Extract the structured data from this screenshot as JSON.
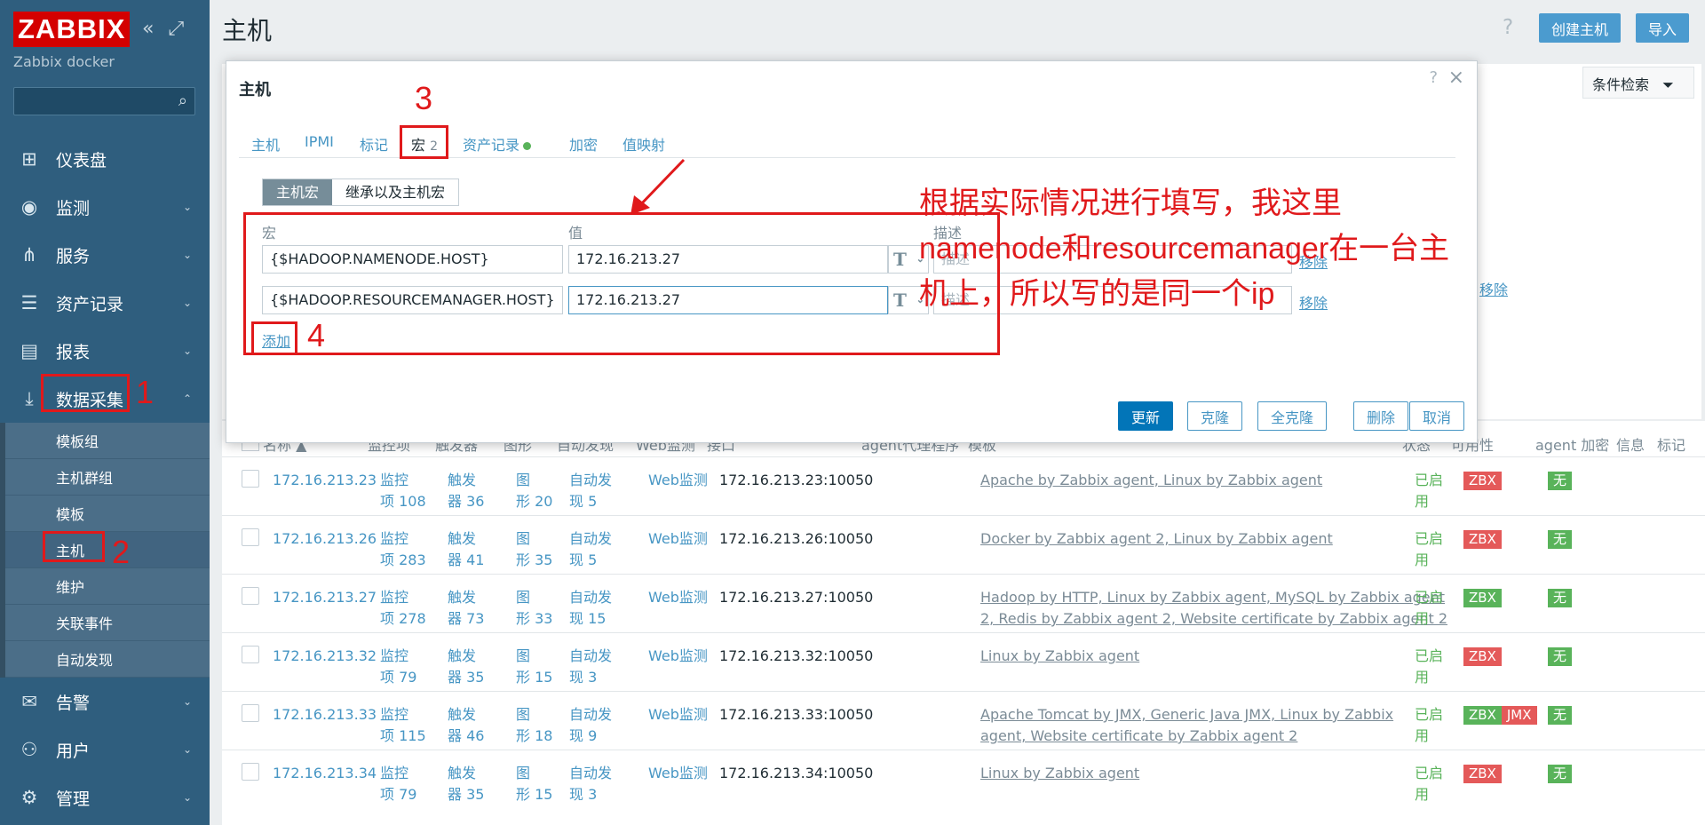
{
  "sidebar": {
    "logo": "ZABBIX",
    "server": "Zabbix docker",
    "collapse_icon": "«",
    "expand_icon": "⤢",
    "menu": [
      {
        "label": "仪表盘",
        "icon": "dashboard-icon"
      },
      {
        "label": "监测",
        "icon": "eye-icon"
      },
      {
        "label": "服务",
        "icon": "services-icon"
      },
      {
        "label": "资产记录",
        "icon": "list-icon"
      },
      {
        "label": "报表",
        "icon": "report-icon"
      },
      {
        "label": "数据采集",
        "icon": "download-icon"
      }
    ],
    "submenu": [
      "模板组",
      "主机群组",
      "模板",
      "主机",
      "维护",
      "关联事件",
      "自动发现"
    ],
    "menu_bottom": [
      {
        "label": "告警",
        "icon": "mail-icon"
      },
      {
        "label": "用户",
        "icon": "users-icon"
      },
      {
        "label": "管理",
        "icon": "gear-icon"
      }
    ]
  },
  "header": {
    "title": "主机",
    "help": "?",
    "create_host": "创建主机",
    "import": "导入",
    "filter_tab": "条件检索",
    "bg_remove": "移除"
  },
  "table": {
    "headers": [
      "名称 ▲",
      "监控项",
      "触发器",
      "图形",
      "自动发现",
      "Web监测",
      "接口",
      "agent代理程序",
      "模板",
      "状态",
      "可用性",
      "agent 加密",
      "信息",
      "标记"
    ],
    "rows": [
      {
        "name": "172.16.213.23",
        "items": [
          "监控",
          "项 108"
        ],
        "triggers": [
          "触发",
          "器 36"
        ],
        "graphs": [
          "图",
          "形 20"
        ],
        "discovery": [
          "自动发",
          "现 5"
        ],
        "web": "Web监测",
        "iface": "172.16.213.23:10050",
        "templates": [
          "Apache by Zabbix agent, Linux by Zabbix agent"
        ],
        "status": [
          "已启",
          "用"
        ],
        "badges": [
          {
            "t": "ZBX",
            "c": "red"
          }
        ],
        "enc": "无"
      },
      {
        "name": "172.16.213.26",
        "items": [
          "监控",
          "项 283"
        ],
        "triggers": [
          "触发",
          "器 41"
        ],
        "graphs": [
          "图",
          "形 35"
        ],
        "discovery": [
          "自动发",
          "现 5"
        ],
        "web": "Web监测",
        "iface": "172.16.213.26:10050",
        "templates": [
          "Docker by Zabbix agent 2, Linux by Zabbix agent"
        ],
        "status": [
          "已启",
          "用"
        ],
        "badges": [
          {
            "t": "ZBX",
            "c": "red"
          }
        ],
        "enc": "无"
      },
      {
        "name": "172.16.213.27",
        "items": [
          "监控",
          "项 278"
        ],
        "triggers": [
          "触发",
          "器 73"
        ],
        "graphs": [
          "图",
          "形 33"
        ],
        "discovery": [
          "自动发",
          "现 15"
        ],
        "web": "Web监测",
        "iface": "172.16.213.27:10050",
        "templates": [
          "Hadoop by HTTP, Linux by Zabbix agent, MySQL by Zabbix agent",
          "2, Redis by Zabbix agent 2, Website certificate by Zabbix agent 2"
        ],
        "status": [
          "已启",
          "用"
        ],
        "badges": [
          {
            "t": "ZBX",
            "c": "green"
          }
        ],
        "enc": "无"
      },
      {
        "name": "172.16.213.32",
        "items": [
          "监控",
          "项 79"
        ],
        "triggers": [
          "触发",
          "器 35"
        ],
        "graphs": [
          "图",
          "形 15"
        ],
        "discovery": [
          "自动发",
          "现 3"
        ],
        "web": "Web监测",
        "iface": "172.16.213.32:10050",
        "templates": [
          "Linux by Zabbix agent"
        ],
        "status": [
          "已启",
          "用"
        ],
        "badges": [
          {
            "t": "ZBX",
            "c": "red"
          }
        ],
        "enc": "无"
      },
      {
        "name": "172.16.213.33",
        "items": [
          "监控",
          "项 115"
        ],
        "triggers": [
          "触发",
          "器 46"
        ],
        "graphs": [
          "图",
          "形 18"
        ],
        "discovery": [
          "自动发",
          "现 9"
        ],
        "web": "Web监测",
        "iface": "172.16.213.33:10050",
        "templates": [
          "Apache Tomcat by JMX, Generic Java JMX, Linux by Zabbix",
          "agent, Website certificate by Zabbix agent 2"
        ],
        "status": [
          "已启",
          "用"
        ],
        "badges": [
          {
            "t": "ZBX",
            "c": "green"
          },
          {
            "t": "JMX",
            "c": "red"
          }
        ],
        "enc": "无"
      },
      {
        "name": "172.16.213.34",
        "items": [
          "监控",
          "项 79"
        ],
        "triggers": [
          "触发",
          "器 35"
        ],
        "graphs": [
          "图",
          "形 15"
        ],
        "discovery": [
          "自动发",
          "现 3"
        ],
        "web": "Web监测",
        "iface": "172.16.213.34:10050",
        "templates": [
          "Linux by Zabbix agent"
        ],
        "status": [
          "已启",
          "用"
        ],
        "badges": [
          {
            "t": "ZBX",
            "c": "red"
          }
        ],
        "enc": "无"
      }
    ]
  },
  "modal": {
    "title": "主机",
    "help": "?",
    "close": "×",
    "tabs": [
      "主机",
      "IPMI",
      "标记",
      "宏",
      "资产记录",
      "加密",
      "值映射"
    ],
    "macro_count": "2",
    "seg_on": "主机宏",
    "seg_off": "继承以及主机宏",
    "col_macro": "宏",
    "col_value": "值",
    "col_desc": "描述",
    "macros": [
      {
        "macro": "{$HADOOP.NAMENODE.HOST}",
        "value": "172.16.213.27",
        "desc_ph": "描述",
        "remove": "移除"
      },
      {
        "macro": "{$HADOOP.RESOURCEMANAGER.HOST}",
        "value": "172.16.213.27",
        "desc_ph": "描述",
        "remove": "移除"
      }
    ],
    "type_glyph": "T",
    "add": "添加",
    "buttons": {
      "update": "更新",
      "clone": "克隆",
      "full_clone": "全克隆",
      "delete": "删除",
      "cancel": "取消"
    }
  },
  "annotations": {
    "n1": "1",
    "n2": "2",
    "n3": "3",
    "n4": "4",
    "note_line1": "根据实际情况进行填写，我这里",
    "note_line2": "namenode和resourcemanager在一台主机上，所以写的是同一个ip"
  },
  "colors": {
    "sidebar": "#2f5e7e",
    "accent": "#0275b8",
    "annotation": "#e0191b",
    "link": "#4796c4"
  }
}
